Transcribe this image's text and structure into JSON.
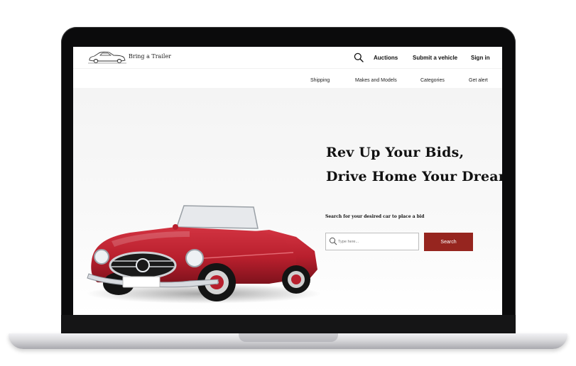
{
  "header": {
    "logo_text": "Bring a Trailer",
    "nav": [
      "Auctions",
      "Submit a vehicle",
      "Sign in"
    ],
    "subnav": [
      "Shipping",
      "Makes and Models",
      "Categories",
      "Get alert"
    ]
  },
  "hero": {
    "title_line1": "Rev Up Your Bids,",
    "title_line2": "Drive Home Your Dream",
    "subtitle": "Search for your desired car to place a bid",
    "search_placeholder": "Type here...",
    "search_button": "Search"
  },
  "colors": {
    "accent": "#96251f",
    "car_body": "#b81f2d"
  }
}
